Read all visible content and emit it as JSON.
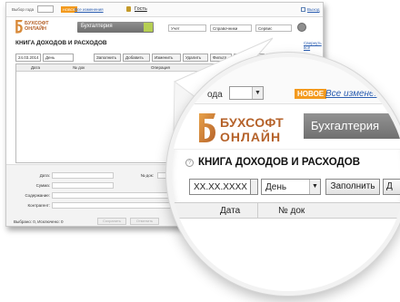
{
  "topbar": {
    "year_label": "Выбор года",
    "new_badge": "НОВОЕ",
    "all_changes": "Все изменения",
    "user": "Гость",
    "exit": "Выход"
  },
  "brand": {
    "line1": "БУХСОФТ",
    "line2": "ОНЛАЙН",
    "department": "Бухгалтерия"
  },
  "menu": [
    "Учет",
    "Справочники",
    "Сервис"
  ],
  "page": {
    "title": "КНИГА ДОХОДОВ И РАСХОДОВ",
    "show_all": "Свернуть всё",
    "help_icon": "?"
  },
  "toolbar": {
    "date_value": "24.03.2014",
    "period": "День",
    "buttons": [
      "Заполнить",
      "Добавить",
      "Изменить",
      "Удалить",
      "Фильтр",
      "Исключена",
      "Печать"
    ]
  },
  "grid": {
    "columns": [
      "Дата",
      "№ док",
      "Операция",
      "Исключена"
    ]
  },
  "form": {
    "date_label": "Дата:",
    "doc_label": "№ док:",
    "sum_label": "Сумма:",
    "content_label": "Содержание:",
    "counterparty_label": "Контрагент:",
    "status": "Выбрано: 0, Исключено: 0",
    "save": "Сохранить",
    "cancel": "Отменить"
  },
  "zoom": {
    "date_placeholder": "XX.XX.XXXX",
    "period": "День",
    "fill": "Заполнить",
    "more": "Д",
    "col_date": "Дата",
    "col_num": "№ док"
  },
  "colors": {
    "brand_orange": "#b5622a",
    "accent_green": "#b6cf53",
    "badge_orange": "#f39a1e",
    "link_blue": "#2a5db0"
  }
}
